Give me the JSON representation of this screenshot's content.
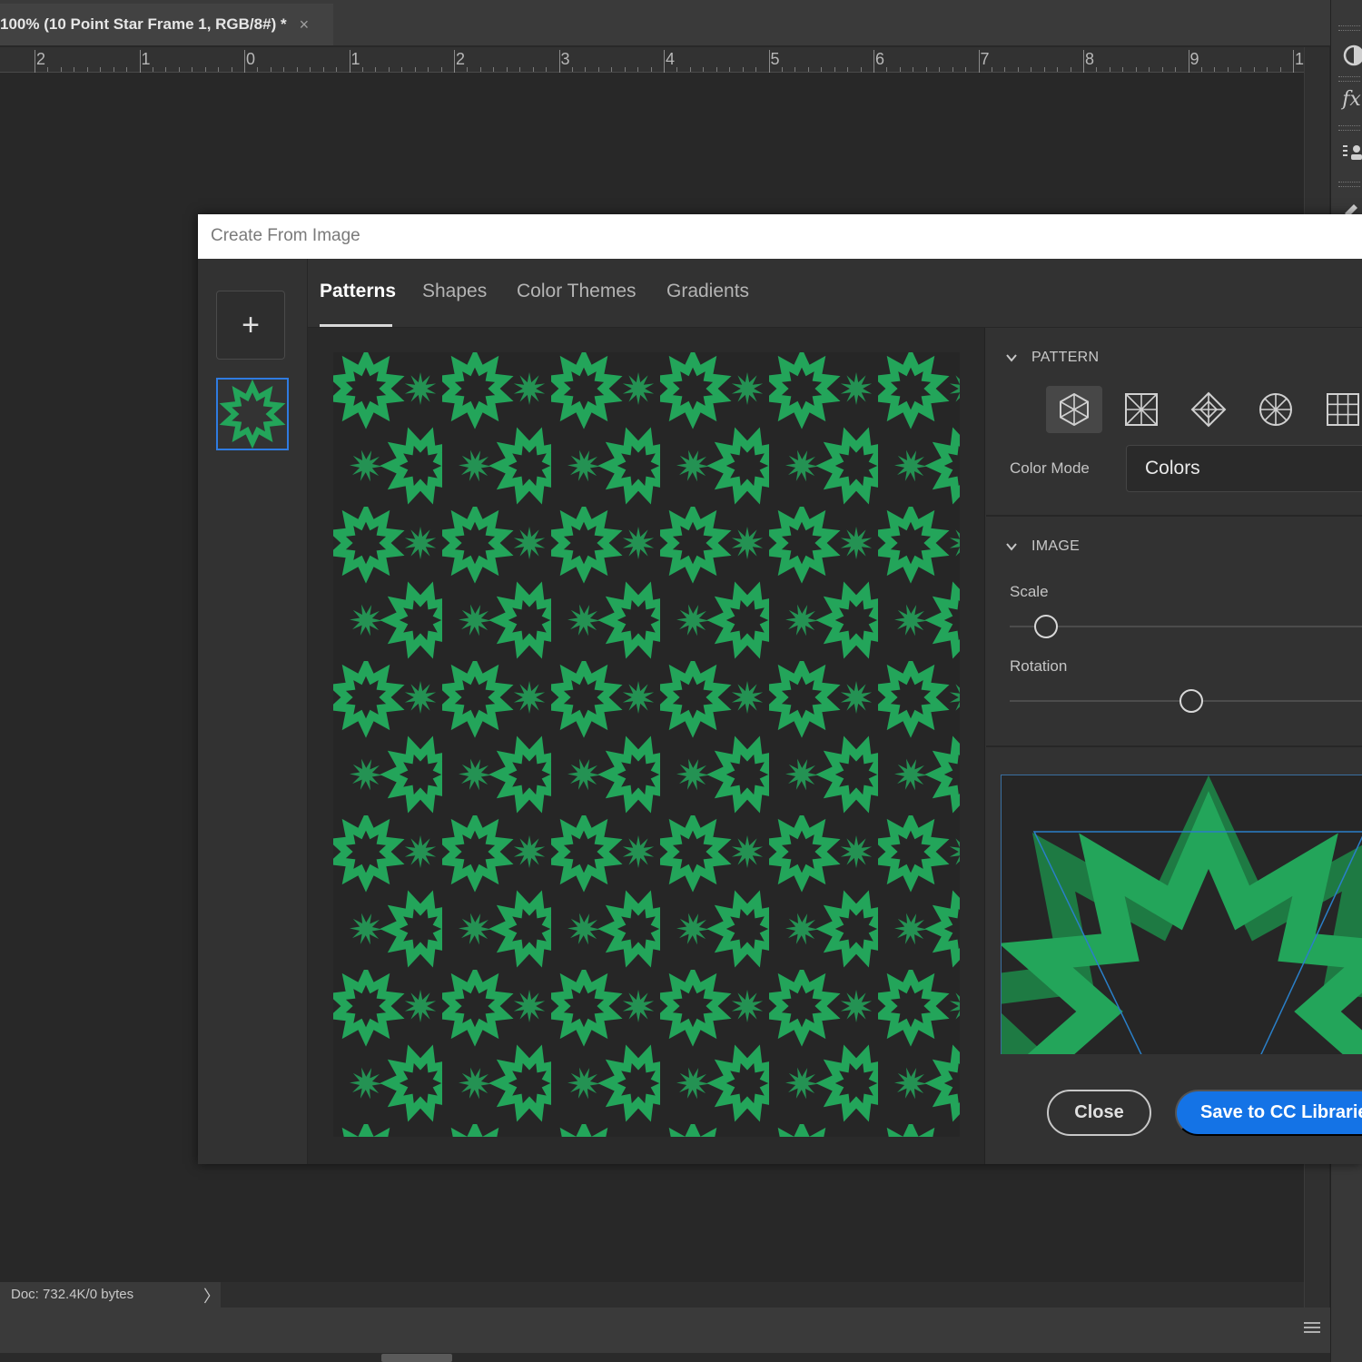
{
  "document_tab": {
    "title": "100% (10 Point Star Frame 1, RGB/8#) *",
    "close_glyph": "×"
  },
  "ruler": {
    "labels": [
      "2",
      "1",
      "0",
      "1",
      "2",
      "3",
      "4",
      "5",
      "6",
      "7",
      "8",
      "9",
      "1"
    ]
  },
  "dialog": {
    "title": "Create From Image",
    "add_glyph": "+",
    "tabs": [
      {
        "label": "Patterns",
        "active": true
      },
      {
        "label": "Shapes",
        "active": false
      },
      {
        "label": "Color Themes",
        "active": false
      },
      {
        "label": "Gradients",
        "active": false
      }
    ],
    "pattern_section": {
      "heading": "PATTERN",
      "types": [
        "hex-grid-icon",
        "diamond-grid-icon",
        "rhombus-icon",
        "circle-wedge-icon",
        "square-grid-icon"
      ],
      "selected_type": 0,
      "color_mode_label": "Color Mode",
      "color_mode_value": "Colors"
    },
    "image_section": {
      "heading": "IMAGE",
      "scale_label": "Scale",
      "scale_value": 0.1,
      "rotation_label": "Rotation",
      "rotation_value": 0.5
    },
    "buttons": {
      "close": "Close",
      "save": "Save to CC Libraries"
    }
  },
  "status_bar": {
    "doc": "Doc: 732.4K/0 bytes",
    "arrow_glyph": "〉"
  },
  "colors": {
    "pattern_green": "#23a55a",
    "pattern_dark_green": "#1e7a43",
    "accent_blue": "#1473e6",
    "selection_blue": "#2f7be0"
  },
  "right_dock": {
    "icons": [
      "adjustments-icon",
      "fx-icon",
      "properties-icon",
      "tools-icon"
    ]
  }
}
